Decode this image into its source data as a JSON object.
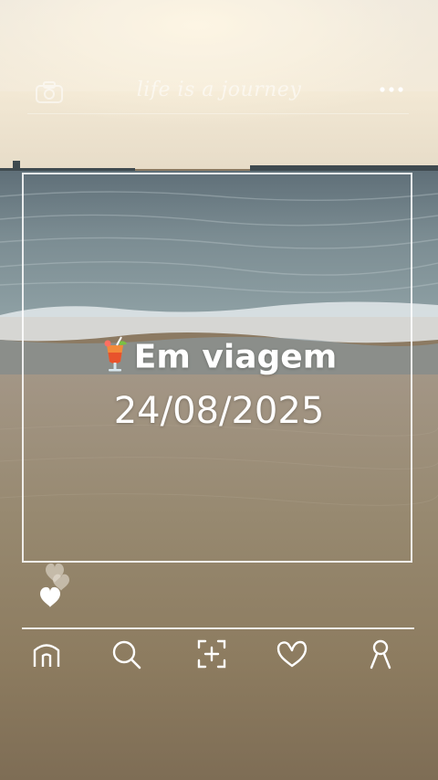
{
  "header": {
    "title": "life is a journey",
    "left_icon": "camera-icon",
    "right_icon": "more-icon"
  },
  "caption": {
    "emoji": "tropical-drink-icon",
    "title": "Em viagem",
    "date": "24/08/2025"
  },
  "reactions": {
    "icon": "hearts-icon"
  },
  "bottom_nav": {
    "items": [
      {
        "icon": "home-icon"
      },
      {
        "icon": "search-icon"
      },
      {
        "icon": "add-post-icon"
      },
      {
        "icon": "heart-icon"
      },
      {
        "icon": "profile-icon"
      }
    ]
  },
  "colors": {
    "sky_top": "#e6dccb",
    "sea": "#6f7f86",
    "sand": "#8f7d63",
    "ui_white": "#ffffff"
  }
}
